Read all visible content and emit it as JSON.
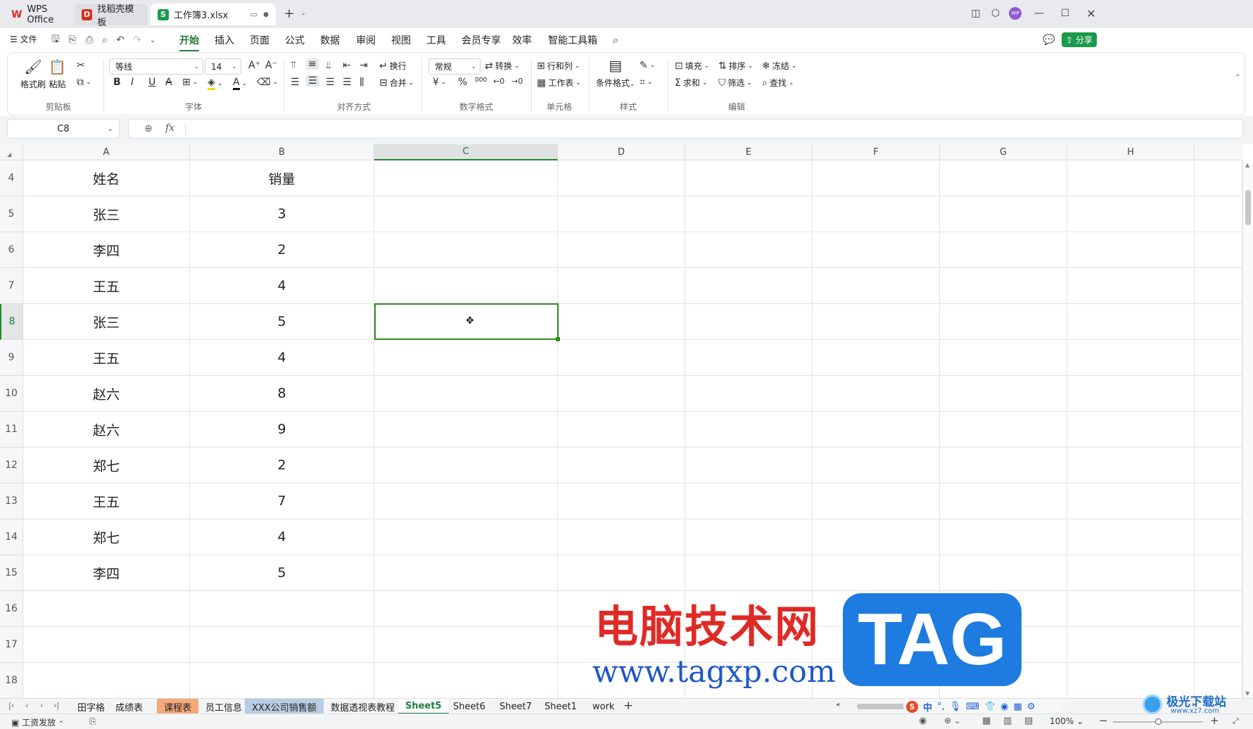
{
  "titlebar": {
    "tabs": [
      {
        "label": "WPS Office",
        "icon": "wps-logo-icon",
        "color": "#d92d20"
      },
      {
        "label": "找稻壳模板",
        "icon": "docer-icon",
        "color": "#d92d20"
      },
      {
        "label": "工作簿3.xlsx",
        "icon": "spreadsheet-icon",
        "color": "#1a9b4b"
      }
    ],
    "new_tab": "+",
    "avatar": "WP"
  },
  "menubar": {
    "file": "文件",
    "tabs": [
      "开始",
      "插入",
      "页面",
      "公式",
      "数据",
      "审阅",
      "视图",
      "工具",
      "会员专享",
      "效率",
      "智能工具箱"
    ],
    "active_tab": "开始",
    "share": "分享"
  },
  "ribbon": {
    "clipboard": {
      "format_painter": "格式刷",
      "paste": "粘贴",
      "group": "剪贴板"
    },
    "font": {
      "name": "等线",
      "size": "14",
      "group": "字体"
    },
    "alignment": {
      "wrap": "换行",
      "merge": "合并",
      "group": "对齐方式"
    },
    "number": {
      "format": "常规",
      "convert": "转换",
      "currency": "¥",
      "percent": "%",
      "thousands": "000",
      "group": "数字格式"
    },
    "cells": {
      "rows_cols": "行和列",
      "worksheet": "工作表",
      "group": "单元格"
    },
    "styles": {
      "conditional": "条件格式",
      "group": "样式"
    },
    "editing": {
      "fill": "填充",
      "sort": "排序",
      "freeze": "冻结",
      "sum": "求和",
      "filter": "筛选",
      "find": "查找",
      "group": "编辑"
    }
  },
  "formula_bar": {
    "name_box": "C8",
    "fx": "fx",
    "value": ""
  },
  "grid": {
    "columns": [
      "A",
      "B",
      "C",
      "D",
      "E",
      "F",
      "G",
      "H"
    ],
    "selected_column": "C",
    "selected_cell": "C8",
    "rows": [
      {
        "num": "4",
        "a": "姓名",
        "b": "销量"
      },
      {
        "num": "5",
        "a": "张三",
        "b": "3"
      },
      {
        "num": "6",
        "a": "李四",
        "b": "2"
      },
      {
        "num": "7",
        "a": "王五",
        "b": "4"
      },
      {
        "num": "8",
        "a": "张三",
        "b": "5"
      },
      {
        "num": "9",
        "a": "王五",
        "b": "4"
      },
      {
        "num": "10",
        "a": "赵六",
        "b": "8"
      },
      {
        "num": "11",
        "a": "赵六",
        "b": "9"
      },
      {
        "num": "12",
        "a": "郑七",
        "b": "2"
      },
      {
        "num": "13",
        "a": "王五",
        "b": "7"
      },
      {
        "num": "14",
        "a": "郑七",
        "b": "4"
      },
      {
        "num": "15",
        "a": "李四",
        "b": "5"
      },
      {
        "num": "16",
        "a": "",
        "b": ""
      },
      {
        "num": "17",
        "a": "",
        "b": ""
      },
      {
        "num": "18",
        "a": "",
        "b": ""
      }
    ]
  },
  "sheets": [
    {
      "label": "田字格",
      "bg": ""
    },
    {
      "label": "成绩表",
      "bg": ""
    },
    {
      "label": "课程表",
      "bg": "#f4a97a"
    },
    {
      "label": "员工信息",
      "bg": ""
    },
    {
      "label": "XXX公司销售额",
      "bg": "#b8cce4"
    },
    {
      "label": "数据透视表教程",
      "bg": ""
    },
    {
      "label": "Sheet5",
      "bg": "#ffffff",
      "active": true
    },
    {
      "label": "Sheet6",
      "bg": ""
    },
    {
      "label": "Sheet7",
      "bg": ""
    },
    {
      "label": "Sheet1",
      "bg": ""
    },
    {
      "label": "work",
      "bg": ""
    }
  ],
  "statusbar": {
    "macro": "工资发放",
    "zoom": "100%"
  },
  "watermark": {
    "text_cn": "电脑技术网",
    "url": "www.tagxp.com",
    "badge": "TAG",
    "site2": "极光下载站",
    "site2_url": "www.xz7.com"
  },
  "colors": {
    "accent": "#1f7a3e",
    "selection": "#2e8b1f",
    "share": "#1a9b4b"
  }
}
